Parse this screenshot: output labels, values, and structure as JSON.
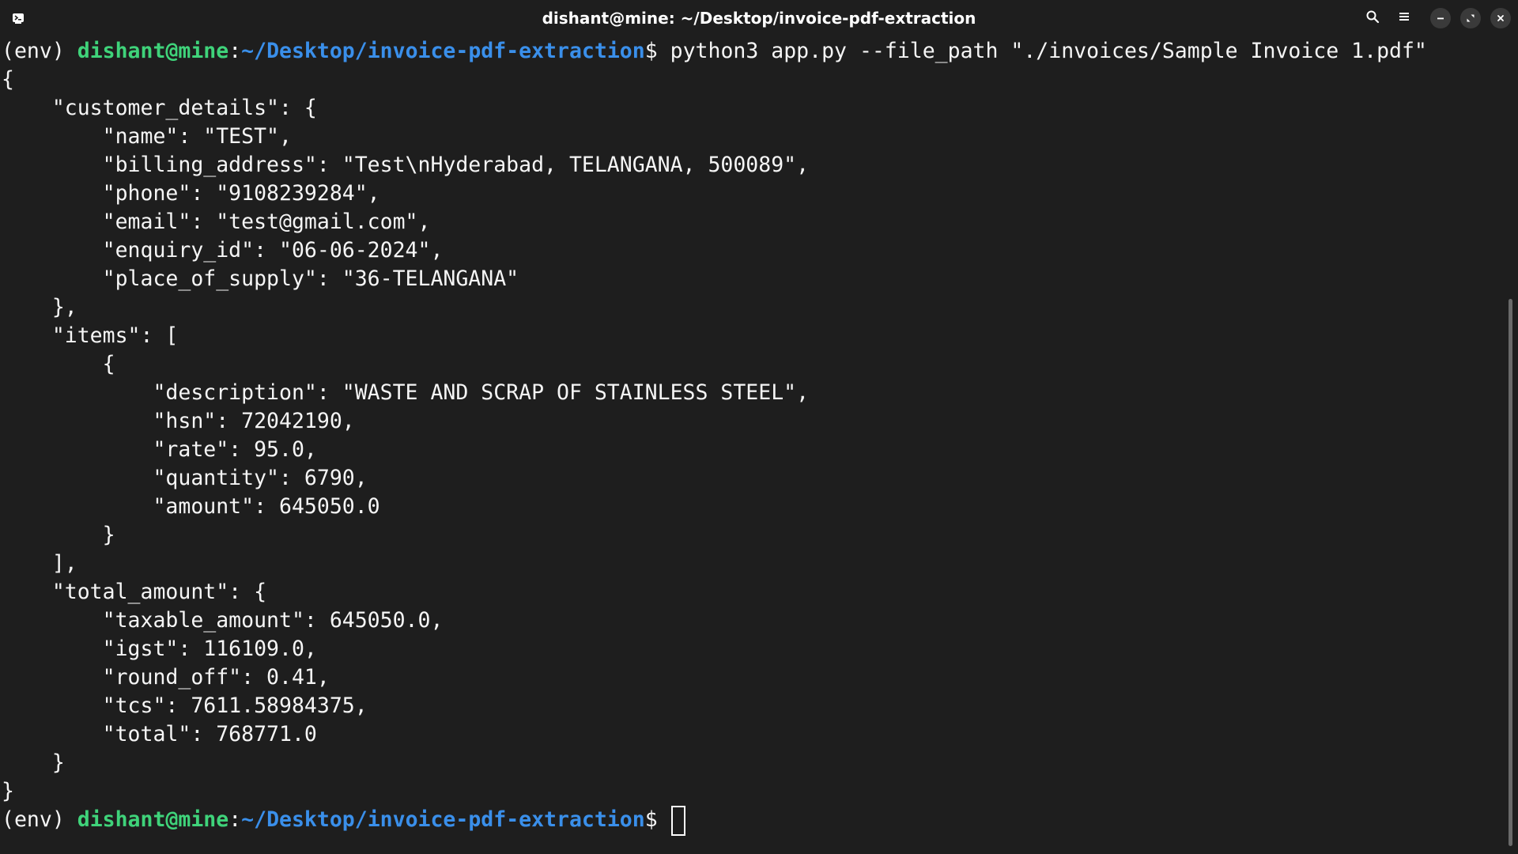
{
  "window": {
    "title": "dishant@mine: ~/Desktop/invoice-pdf-extraction",
    "icons": {
      "app": "terminal-icon",
      "search": "search-icon",
      "menu": "hamburger-menu-icon",
      "minimize": "minimize-icon",
      "restore": "restore-icon",
      "close": "close-icon"
    }
  },
  "colors": {
    "background": "#1e1e1e",
    "text": "#f5f5f5",
    "user_host": "#3fd37a",
    "path": "#3a8fea"
  },
  "prompt": {
    "env": "(env) ",
    "user_host": "dishant@mine",
    "separator": ":",
    "path": "~/Desktop/invoice-pdf-extraction",
    "symbol": "$ "
  },
  "command": "python3 app.py --file_path \"./invoices/Sample Invoice 1.pdf\"",
  "output_lines": [
    "{",
    "    \"customer_details\": {",
    "        \"name\": \"TEST\",",
    "        \"billing_address\": \"Test\\nHyderabad, TELANGANA, 500089\",",
    "        \"phone\": \"9108239284\",",
    "        \"email\": \"test@gmail.com\",",
    "        \"enquiry_id\": \"06-06-2024\",",
    "        \"place_of_supply\": \"36-TELANGANA\"",
    "    },",
    "    \"items\": [",
    "        {",
    "            \"description\": \"WASTE AND SCRAP OF STAINLESS STEEL\",",
    "            \"hsn\": 72042190,",
    "            \"rate\": 95.0,",
    "            \"quantity\": 6790,",
    "            \"amount\": 645050.0",
    "        }",
    "    ],",
    "    \"total_amount\": {",
    "        \"taxable_amount\": 645050.0,",
    "        \"igst\": 116109.0,",
    "        \"round_off\": 0.41,",
    "        \"tcs\": 7611.58984375,",
    "        \"total\": 768771.0",
    "    }",
    "}"
  ]
}
